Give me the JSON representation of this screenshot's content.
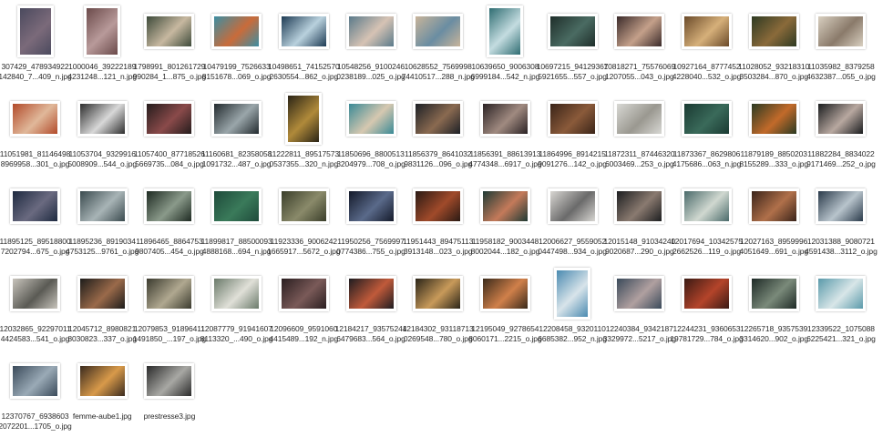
{
  "files": [
    {
      "line1": "307429_478934922",
      "line2": "142840_7...409_n.jpg",
      "orient": "port",
      "colors": [
        "#4b4a5e",
        "#7b6a7a"
      ]
    },
    {
      "line1": "1000046_39222189",
      "line2": "4231248...121_n.jpg",
      "orient": "port",
      "colors": [
        "#6b4a4a",
        "#b89a9a"
      ]
    },
    {
      "line1": "1798991_801261729",
      "line2": "990284_1...875_o.jpg",
      "orient": "land",
      "colors": [
        "#3d4a3a",
        "#c7b8a0"
      ]
    },
    {
      "line1": "10479199_7526633",
      "line2": "8151678...069_o.jpg",
      "orient": "land",
      "colors": [
        "#3c8ea3",
        "#c96b3a"
      ]
    },
    {
      "line1": "10498651_74152570",
      "line2": "2630554...862_o.jpg",
      "orient": "land",
      "colors": [
        "#1e3b54",
        "#b9d1dd"
      ]
    },
    {
      "line1": "10548256_9100246",
      "line2": "0238189...025_o.jpg",
      "orient": "land",
      "colors": [
        "#5a7a8a",
        "#d6c3b4"
      ]
    },
    {
      "line1": "10628552_7569998",
      "line2": "74410517...288_n.jpg",
      "orient": "land",
      "colors": [
        "#c8b49a",
        "#6a8da2"
      ]
    },
    {
      "line1": "10639650_9006308",
      "line2": "6999184...542_n.jpg",
      "orient": "port",
      "colors": [
        "#2f6d72",
        "#c4dce0"
      ]
    },
    {
      "line1": "10697215_94129367",
      "line2": "5921655...557_o.jpg",
      "orient": "land",
      "colors": [
        "#1e2e2a",
        "#4a6b62"
      ]
    },
    {
      "line1": "10818271_75576069",
      "line2": "1207055...043_o.jpg",
      "orient": "land",
      "colors": [
        "#3a2a2a",
        "#c4a08a"
      ]
    },
    {
      "line1": "10927164_8777452",
      "line2": "4228040...532_o.jpg",
      "orient": "land",
      "colors": [
        "#6a4a2a",
        "#d6b07a"
      ]
    },
    {
      "line1": "11028052_93218310",
      "line2": "3503284...870_o.jpg",
      "orient": "land",
      "colors": [
        "#2e3a22",
        "#8a6a3a"
      ]
    },
    {
      "line1": "11035982_8379258",
      "line2": "4632387...055_o.jpg",
      "orient": "land",
      "colors": [
        "#d8cfc0",
        "#8a7a6a"
      ]
    },
    {
      "line1": "11051981_81146498",
      "line2": "8969958...301_o.jpg",
      "orient": "land",
      "colors": [
        "#b24a2a",
        "#e0b89a"
      ]
    },
    {
      "line1": "11053704_9329916",
      "line2": "5008909...544_o.jpg",
      "orient": "land",
      "colors": [
        "#2e2e2e",
        "#d8d8d8"
      ]
    },
    {
      "line1": "11057400_87718526",
      "line2": "5669735...084_o.jpg",
      "orient": "land",
      "colors": [
        "#241c1c",
        "#8a4a4a"
      ]
    },
    {
      "line1": "11160681_82358058",
      "line2": "1091732...487_o.jpg",
      "orient": "land",
      "colors": [
        "#222a2e",
        "#9aa6aa"
      ]
    },
    {
      "line1": "11222811_89517573",
      "line2": "0537355...320_n.jpg",
      "orient": "port",
      "colors": [
        "#2a2416",
        "#b08a3a"
      ]
    },
    {
      "line1": "11850696_8800513",
      "line2": "3204979...708_o.jpg",
      "orient": "land",
      "colors": [
        "#3a8a96",
        "#d6c8b0"
      ]
    },
    {
      "line1": "11856379_8641032",
      "line2": "9831126...096_o.jpg",
      "orient": "land",
      "colors": [
        "#1c2026",
        "#8a6a50"
      ]
    },
    {
      "line1": "11856391_88613913",
      "line2": "4774348...6917_o.jpg",
      "orient": "land",
      "colors": [
        "#2a2224",
        "#a08a80"
      ]
    },
    {
      "line1": "11864996_8914215",
      "line2": "9091276...142_o.jpg",
      "orient": "land",
      "colors": [
        "#3a2418",
        "#8a5a3a"
      ]
    },
    {
      "line1": "11872311_87446320",
      "line2": "6003469...253_o.jpg",
      "orient": "land",
      "colors": [
        "#d8d8d4",
        "#9a9890"
      ]
    },
    {
      "line1": "11873367_8629806",
      "line2": "4175686...063_n.jpg",
      "orient": "land",
      "colors": [
        "#1a3a32",
        "#3a6a5a"
      ]
    },
    {
      "line1": "11879189_8850203",
      "line2": "8155289...333_o.jpg",
      "orient": "land",
      "colors": [
        "#2a3a22",
        "#c26a2a"
      ]
    },
    {
      "line1": "11882284_8834022",
      "line2": "9171469...252_o.jpg",
      "orient": "land",
      "colors": [
        "#1a1c1e",
        "#b8a8a0"
      ]
    },
    {
      "line1": "11895125_89518800",
      "line2": "7202794...675_o.jpg",
      "orient": "land",
      "colors": [
        "#1e2a40",
        "#6a6a80"
      ]
    },
    {
      "line1": "11895236_8919034",
      "line2": "4753125...9761_o.jpg",
      "orient": "land",
      "colors": [
        "#3a4a4e",
        "#a8b4b6"
      ]
    },
    {
      "line1": "11896465_8864753",
      "line2": "9807405...454_o.jpg",
      "orient": "land",
      "colors": [
        "#1e2a22",
        "#8a9a8a"
      ]
    },
    {
      "line1": "11899817_88500093",
      "line2": "4888168...694_n.jpg",
      "orient": "land",
      "colors": [
        "#1e4a3a",
        "#3a7a5a"
      ]
    },
    {
      "line1": "11923336_9006242",
      "line2": "1665917...5672_o.jpg",
      "orient": "land",
      "colors": [
        "#3a3e2a",
        "#8a8a6a"
      ]
    },
    {
      "line1": "11950256_7569997",
      "line2": "0774386...755_o.jpg",
      "orient": "land",
      "colors": [
        "#141a2a",
        "#5a6a8a"
      ]
    },
    {
      "line1": "11951443_89475113",
      "line2": "3913148...023_o.jpg",
      "orient": "land",
      "colors": [
        "#2a1a14",
        "#a04a2a"
      ]
    },
    {
      "line1": "11958182_9003448",
      "line2": "8002044...182_o.jpg",
      "orient": "land",
      "colors": [
        "#1e3a34",
        "#c47a5a"
      ]
    },
    {
      "line1": "12006627_9559052",
      "line2": "0447498...934_o.jpg",
      "orient": "land",
      "colors": [
        "#d8d6d2",
        "#6a6a6a"
      ]
    },
    {
      "line1": "12015148_91034240",
      "line2": "9020687...290_o.jpg",
      "orient": "land",
      "colors": [
        "#1c1e20",
        "#8a7a70"
      ]
    },
    {
      "line1": "12017694_10342575",
      "line2": "2662526...119_o.jpg",
      "orient": "land",
      "colors": [
        "#4a6a6a",
        "#d0d8d0"
      ]
    },
    {
      "line1": "12027163_8959996",
      "line2": "4051649...691_o.jpg",
      "orient": "land",
      "colors": [
        "#3a241a",
        "#b0704a"
      ]
    },
    {
      "line1": "12031388_9080721",
      "line2": "4591438...3112_o.jpg",
      "orient": "land",
      "colors": [
        "#2a3a4a",
        "#b8c4cc"
      ]
    },
    {
      "line1": "12032865_92297011",
      "line2": "4424583...541_o.jpg",
      "orient": "land",
      "colors": [
        "#c8c4bc",
        "#5a5a54"
      ]
    },
    {
      "line1": "12045712_8980821",
      "line2": "8030823...337_o.jpg",
      "orient": "land",
      "colors": [
        "#1c1c1a",
        "#9a6a4a"
      ]
    },
    {
      "line1": "12079853_91896411",
      "line2": "1491850_...197_o.jpg",
      "orient": "land",
      "colors": [
        "#3a3a2e",
        "#b0a890"
      ]
    },
    {
      "line1": "12087779_91941607",
      "line2": "8113320_...490_o.jpg",
      "orient": "land",
      "colors": [
        "#6a7a6a",
        "#e0e0d8"
      ]
    },
    {
      "line1": "12096609_9591060",
      "line2": "4415489...192_n.jpg",
      "orient": "land",
      "colors": [
        "#2a1e20",
        "#7a5a58"
      ]
    },
    {
      "line1": "12184217_93575244",
      "line2": "6479683...564_o.jpg",
      "orient": "land",
      "colors": [
        "#1e1c20",
        "#c05a3a"
      ]
    },
    {
      "line1": "12184302_93118713",
      "line2": "0269548...780_o.jpg",
      "orient": "land",
      "colors": [
        "#2a2418",
        "#c89a5a"
      ]
    },
    {
      "line1": "12195049_9278654",
      "line2": "8060171...2215_o.jpg",
      "orient": "land",
      "colors": [
        "#3a2a1a",
        "#d0804a"
      ]
    },
    {
      "line1": "12208458_9320110",
      "line2": "6685382...952_n.jpg",
      "orient": "port",
      "colors": [
        "#4a8ab0",
        "#d8e4ea"
      ]
    },
    {
      "line1": "12240384_9342187",
      "line2": "3329972...5217_o.jpg",
      "orient": "land",
      "colors": [
        "#3a4a5a",
        "#b0a0a0"
      ]
    },
    {
      "line1": "12244231_9360653",
      "line2": "19781729...784_o.jpg",
      "orient": "land",
      "colors": [
        "#3a1a14",
        "#b4442a"
      ]
    },
    {
      "line1": "12265718_9357539",
      "line2": "3314620...902_o.jpg",
      "orient": "land",
      "colors": [
        "#1e2a26",
        "#7a8a7a"
      ]
    },
    {
      "line1": "12339522_1075088",
      "line2": "6225421...321_o.jpg",
      "orient": "land",
      "colors": [
        "#5a9aaa",
        "#d8e6e8"
      ]
    },
    {
      "line1": "12370767_6938603",
      "line2": "2072201...1705_o.jpg",
      "orient": "land",
      "colors": [
        "#3a4a5a",
        "#9aaab6"
      ]
    },
    {
      "line1": "femme-aube1.jpg",
      "line2": "",
      "orient": "land",
      "colors": [
        "#3a2a1e",
        "#d89a4a"
      ]
    },
    {
      "line1": "prestresse3.jpg",
      "line2": "",
      "orient": "land",
      "colors": [
        "#2a2a2a",
        "#a8a8a4"
      ]
    }
  ]
}
